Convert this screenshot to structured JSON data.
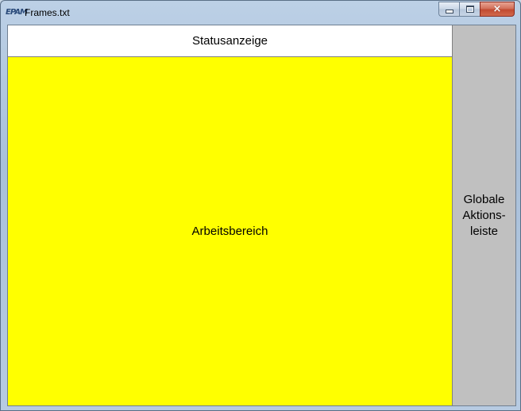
{
  "window": {
    "title": "Frames.txt",
    "app_icon_text": "EPAM",
    "controls": {
      "minimize": "minimize",
      "maximize": "maximize",
      "close": "×"
    }
  },
  "frames": {
    "status_bar": "Statusanzeige",
    "work_area": "Arbeitsbereich",
    "action_bar": "Globale\nAktions-\nleiste"
  },
  "colors": {
    "work_area": "#ffff00",
    "action_bar": "#c0c0c0",
    "status_bar": "#ffffff"
  }
}
